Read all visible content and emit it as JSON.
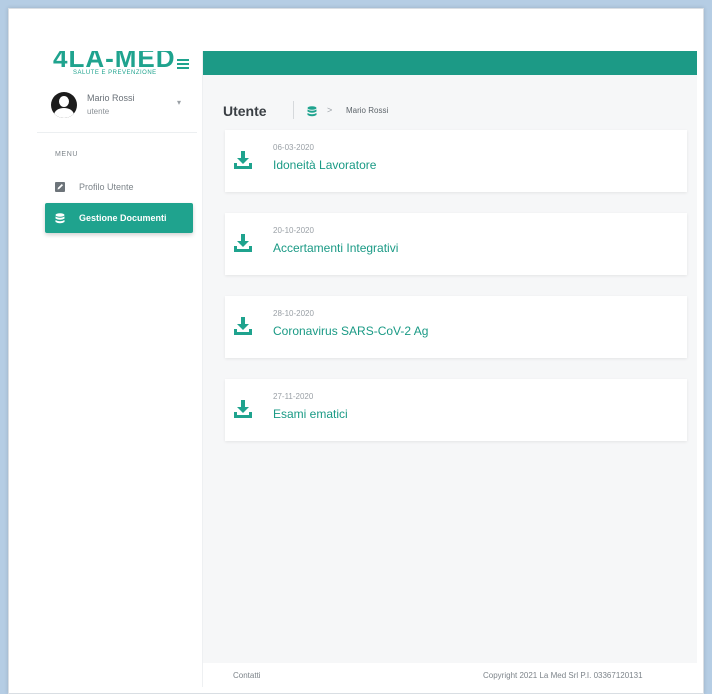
{
  "brand": {
    "logo_text": "4LA-MED",
    "logo_tagline": "SALUTE E PREVENZIONE",
    "accent": "#1fa38e",
    "topbar_color": "#1c9a86"
  },
  "user": {
    "name": "Mario Rossi",
    "role": "utente"
  },
  "sidebar": {
    "menu_label": "MENU",
    "items": [
      {
        "label": "Profilo Utente",
        "icon": "edit-icon",
        "active": false
      },
      {
        "label": "Gestione Documenti",
        "icon": "database-icon",
        "active": true
      }
    ]
  },
  "main": {
    "title": "Utente",
    "breadcrumb": {
      "icon": "database-icon",
      "separator": ">",
      "current": "Mario Rossi"
    },
    "documents": [
      {
        "date": "06-03-2020",
        "title": "Idoneità Lavoratore"
      },
      {
        "date": "20-10-2020",
        "title": "Accertamenti Integrativi"
      },
      {
        "date": "28-10-2020",
        "title": "Coronavirus SARS-CoV-2 Ag"
      },
      {
        "date": "27-11-2020",
        "title": "Esami ematici"
      }
    ]
  },
  "footer": {
    "contact": "Contatti",
    "copyright": "Copyright 2021 La Med Srl P.I. 03367120131"
  }
}
